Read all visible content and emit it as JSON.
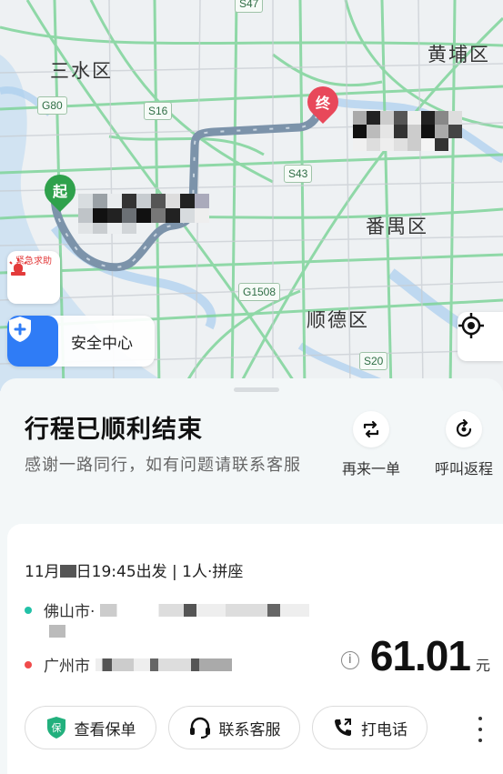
{
  "map": {
    "places": [
      "三水区",
      "黄埔区",
      "番禺区",
      "顺德区"
    ],
    "roads": [
      "S47",
      "G80",
      "S16",
      "S43",
      "G1508",
      "S20"
    ],
    "start_pin": "起",
    "end_pin": "终",
    "sos_label": "紧急求助",
    "safety_center_label": "安全中心"
  },
  "trip": {
    "title": "行程已顺利结束",
    "subtitle": "感谢一路同行，如有问题请联系客服",
    "actions": [
      {
        "label": "再来一单",
        "icon": "repeat-icon"
      },
      {
        "label": "呼叫返程",
        "icon": "return-trip-icon"
      }
    ],
    "time_prefix": "11月",
    "time_suffix": "日19:45出发 | 1人·拼座",
    "origin_city": "佛山市·",
    "destination_city": "广州市",
    "price": "61.01",
    "currency": "元",
    "buttons": [
      {
        "label": "查看保单",
        "icon": "insurance-icon"
      },
      {
        "label": "联系客服",
        "icon": "headset-icon"
      },
      {
        "label": "打电话",
        "icon": "phone-icon"
      }
    ]
  },
  "colors": {
    "start_pin": "#2fa14c",
    "end_pin": "#e8485a",
    "route": "#7c93aa",
    "safety_blue": "#2f7cf6",
    "origin_dot": "#22c1a7",
    "destination_dot": "#f04b4b"
  }
}
